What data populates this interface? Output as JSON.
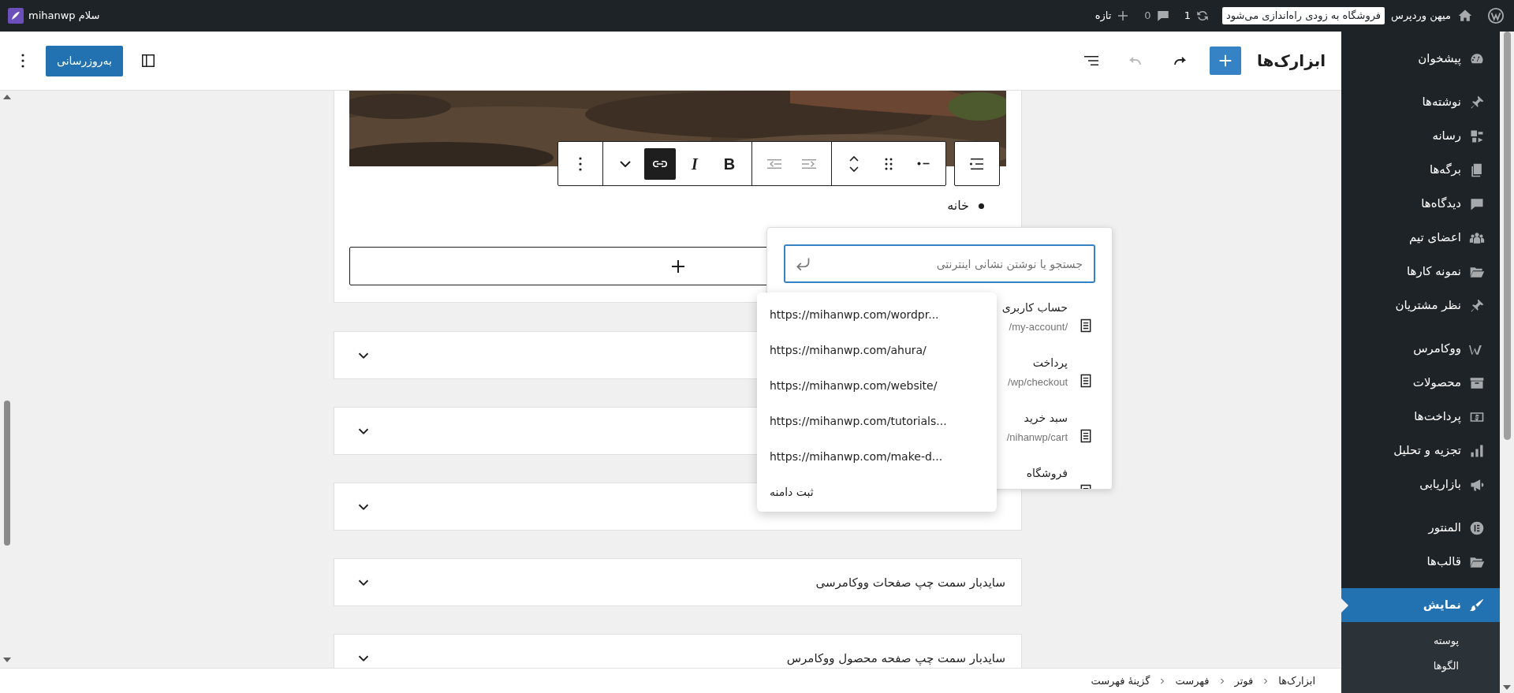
{
  "admin_bar": {
    "site_name": "میهن وردپرس",
    "notice": "فروشگاه به زودی راه‌اندازی می‌شود",
    "updates": "1",
    "comments": "0",
    "new": "تازه",
    "greeting": "سلام mihanwp"
  },
  "header": {
    "title": "ابزارک‌ها",
    "update_button": "به‌روزرسانی",
    "undo_disabled": true,
    "redo_disabled": false
  },
  "sidebar": {
    "groups": [
      [
        {
          "label": "پیشخوان",
          "kind": "dashboard",
          "selected": false
        }
      ],
      [
        {
          "label": "نوشته‌ها",
          "kind": "pin",
          "selected": false
        },
        {
          "label": "رسانه",
          "kind": "media",
          "selected": false
        },
        {
          "label": "برگه‌ها",
          "kind": "pages",
          "selected": false
        },
        {
          "label": "دیدگاه‌ها",
          "kind": "comment",
          "selected": false
        },
        {
          "label": "اعضای تیم",
          "kind": "team",
          "selected": false
        },
        {
          "label": "نمونه کارها",
          "kind": "folder",
          "selected": false
        },
        {
          "label": "نظر مشتریان",
          "kind": "pin",
          "selected": false
        }
      ],
      [
        {
          "label": "ووکامرس",
          "kind": "woo",
          "selected": false
        },
        {
          "label": "محصولات",
          "kind": "archive",
          "selected": false
        },
        {
          "label": "پرداخت‌ها",
          "kind": "payments",
          "selected": false
        },
        {
          "label": "تجزیه و تحلیل",
          "kind": "chart",
          "selected": false
        },
        {
          "label": "بازاریابی",
          "kind": "megaphone",
          "selected": false
        }
      ],
      [
        {
          "label": "المنتور",
          "kind": "elementor",
          "selected": false
        },
        {
          "label": "قالب‌ها",
          "kind": "folder",
          "selected": false
        }
      ],
      [
        {
          "label": "نمایش",
          "kind": "brush",
          "selected": true
        }
      ]
    ],
    "submenu": [
      "پوسته",
      "الگوها"
    ]
  },
  "toolbar": {
    "groups": [
      [
        {
          "kind": "list-style",
          "pressed": false,
          "disabled": false
        }
      ],
      [
        {
          "kind": "list-item",
          "pressed": false,
          "disabled": false
        },
        {
          "kind": "drag",
          "pressed": false,
          "disabled": false
        },
        {
          "kind": "move",
          "pressed": false,
          "disabled": false
        }
      ],
      [
        {
          "kind": "indent",
          "pressed": false,
          "disabled": true
        },
        {
          "kind": "outdent",
          "pressed": false,
          "disabled": true
        }
      ],
      [
        {
          "kind": "bold",
          "label": "B",
          "pressed": false,
          "disabled": false
        },
        {
          "kind": "italic",
          "label": "I",
          "pressed": false,
          "disabled": false
        },
        {
          "kind": "link",
          "pressed": true,
          "disabled": false
        },
        {
          "kind": "more",
          "pressed": false,
          "disabled": false
        }
      ],
      [
        {
          "kind": "options",
          "pressed": false,
          "disabled": false
        }
      ]
    ]
  },
  "list_item": "خانه",
  "link_popover": {
    "placeholder": "جستجو یا نوشتن نشانی اینترنتی",
    "results": [
      {
        "title": "حساب کاربری",
        "url": "/my-account/"
      },
      {
        "title": "پرداخت",
        "url": "wp/checkout/"
      },
      {
        "title": "سبد خرید",
        "url": "nihanwp/cart/"
      },
      {
        "title": "فروشگاه"
      }
    ]
  },
  "suggestions": [
    "https://mihanwp.com/wordpr...",
    "https://mihanwp.com/ahura/",
    "https://mihanwp.com/website/",
    "https://mihanwp.com/tutorials...",
    "https://mihanwp.com/make-d...",
    "ثبت دامنه"
  ],
  "accordions": [
    {
      "expanded": false
    },
    {
      "expanded": false
    },
    {
      "expanded": false
    },
    {
      "title": "سایدبار سمت چپ صفحات ووکامرسی",
      "expanded": false
    },
    {
      "title": "سایدبار سمت چپ صفحه محصول ووکامرس",
      "expanded": false
    }
  ],
  "breadcrumb": [
    "ابزارک‌ها",
    "فوتر",
    "فهرست",
    "گزینهٔ فهرست"
  ]
}
